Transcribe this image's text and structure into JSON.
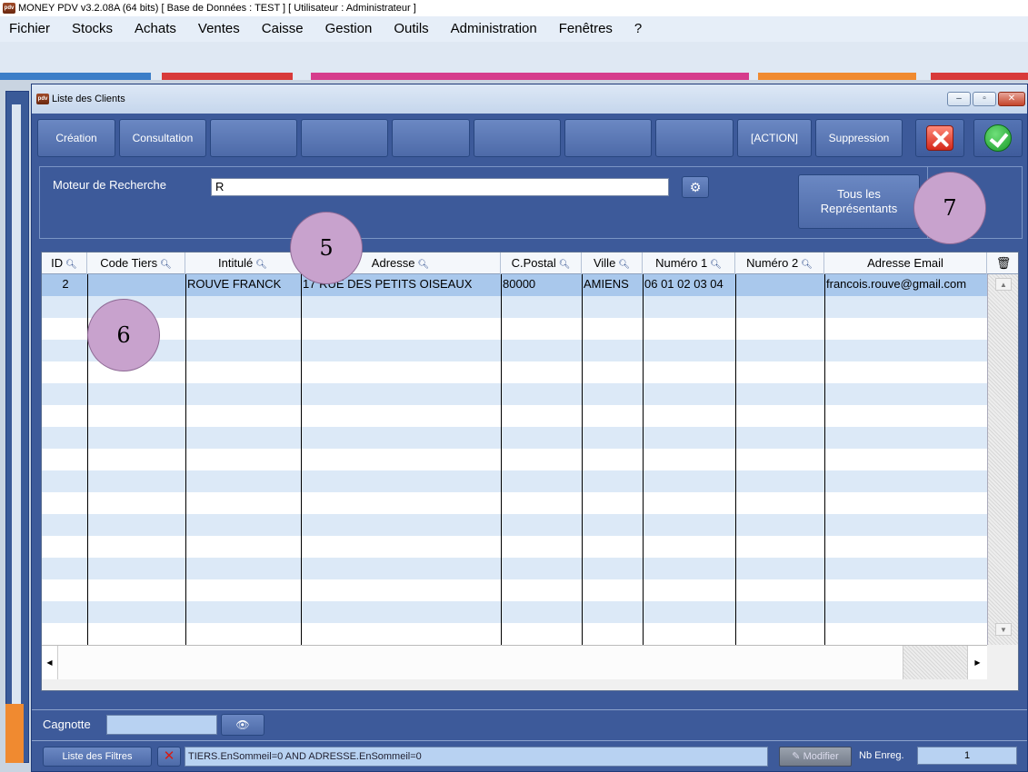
{
  "app": {
    "title": "MONEY PDV v3.2.08A (64 bits) [ Base de Données : TEST ] [ Utilisateur : Administrateur ]",
    "logo": "pdv"
  },
  "menu": [
    "Fichier",
    "Stocks",
    "Achats",
    "Ventes",
    "Caisse",
    "Gestion",
    "Outils",
    "Administration",
    "Fenêtres",
    "?"
  ],
  "dialog": {
    "title": "Liste des Clients",
    "window_buttons": {
      "minimize": "‒",
      "maximize": "▫",
      "close": "✕"
    }
  },
  "toolbar": {
    "creation": "Création",
    "consultation": "Consultation",
    "action": "[ACTION]",
    "suppression": "Suppression"
  },
  "search": {
    "label": "Moteur de Recherche",
    "value": "R",
    "go_icon": "gear-search-icon",
    "representants_line1": "Tous les",
    "representants_line2": "Représentants"
  },
  "table": {
    "columns": [
      "ID",
      "Code Tiers",
      "Intitulé",
      "Adresse",
      "C.Postal",
      "Ville",
      "Numéro 1",
      "Numéro 2",
      "Adresse Email"
    ],
    "rows": [
      [
        "2",
        "",
        "ROUVE FRANCK",
        "17 RUE DES PETITS OISEAUX",
        "80000",
        "AMIENS",
        "06 01 02 03 04",
        "",
        "francois.rouve@gmail.com"
      ]
    ]
  },
  "cagnotte": {
    "label": "Cagnotte",
    "value": ""
  },
  "filters": {
    "button": "Liste des Filtres",
    "clear": "✕",
    "expression": "TIERS.EnSommeil=0 AND ADRESSE.EnSommeil=0",
    "modify": "Modifier",
    "count_label": "Nb Enreg.",
    "count_value": "1"
  },
  "annotations": [
    "5",
    "6",
    "7"
  ],
  "colors": {
    "accent": "#3d5a9a",
    "marker": "#c8a2cd",
    "selected_row": "#a9c8ec"
  }
}
